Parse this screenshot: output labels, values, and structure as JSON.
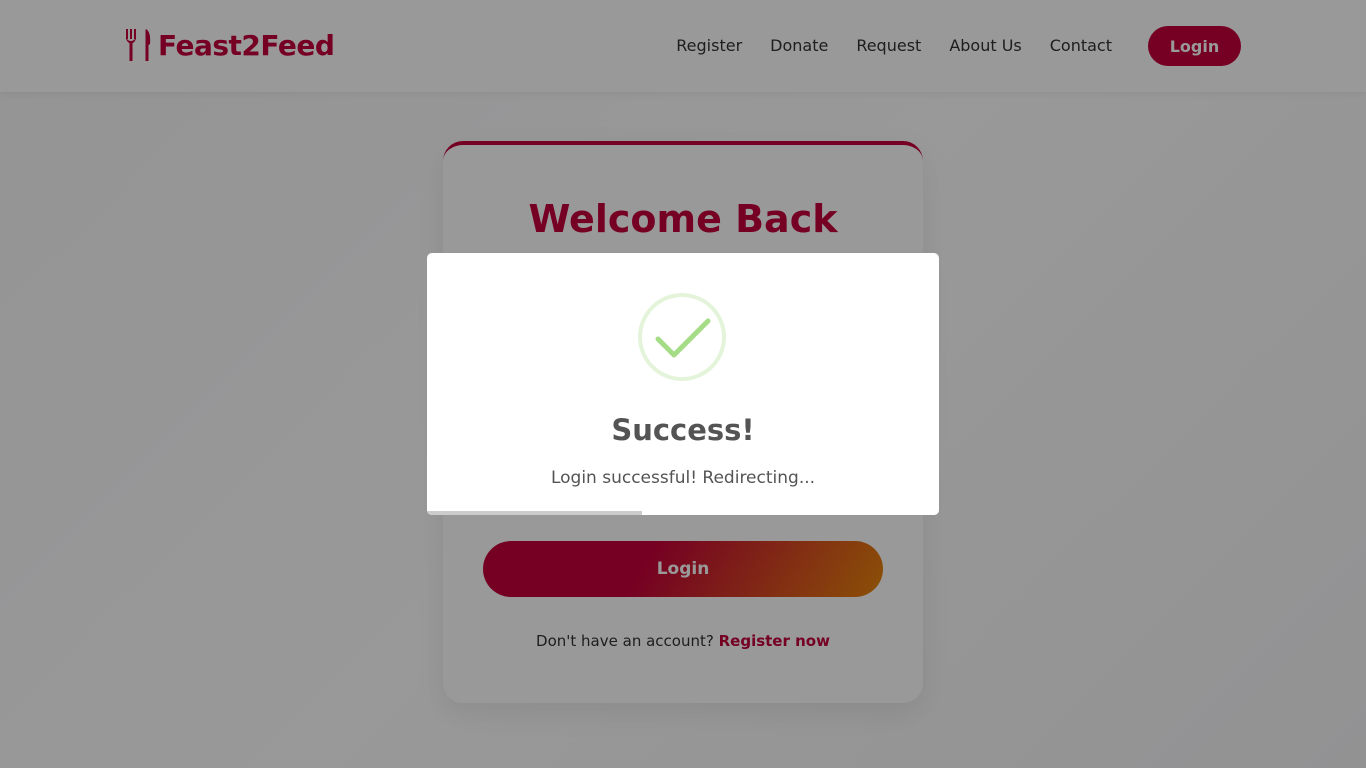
{
  "header": {
    "brand": "Feast2Feed",
    "nav": [
      "Register",
      "Donate",
      "Request",
      "About Us",
      "Contact"
    ],
    "login_label": "Login"
  },
  "card": {
    "title": "Welcome Back",
    "submit_label": "Login",
    "footer_text": "Don't have an account?",
    "footer_link": "Register now"
  },
  "modal": {
    "title": "Success!",
    "text": "Login successful! Redirecting...",
    "timer_progress": 0.42
  },
  "colors": {
    "brand": "#c4003b",
    "accent_orange": "#e8870c",
    "success_green": "#a5dc86"
  },
  "icons": {
    "brand": "fork-knife-icon",
    "success": "checkmark-circle-icon"
  }
}
